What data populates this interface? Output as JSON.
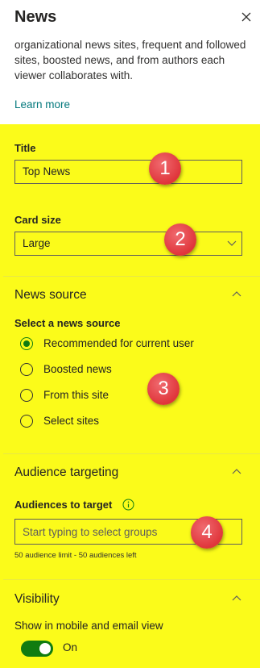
{
  "panel": {
    "title": "News",
    "description": "organizational news sites, frequent and followed sites, boosted news, and from authors each viewer collaborates with.",
    "learn_more": "Learn more"
  },
  "title_field": {
    "label": "Title",
    "value": "Top News"
  },
  "card_size": {
    "label": "Card size",
    "value": "Large"
  },
  "news_source": {
    "section_title": "News source",
    "subheading": "Select a news source",
    "options": [
      {
        "label": "Recommended for current user",
        "checked": true
      },
      {
        "label": "Boosted news",
        "checked": false
      },
      {
        "label": "From this site",
        "checked": false
      },
      {
        "label": "Select sites",
        "checked": false
      }
    ]
  },
  "audience": {
    "section_title": "Audience targeting",
    "label": "Audiences to target",
    "placeholder": "Start typing to select groups",
    "limit_note": "50 audience limit - 50 audiences left"
  },
  "visibility": {
    "section_title": "Visibility",
    "toggle_label": "Show in mobile and email view",
    "toggle_state": "On",
    "enabled": true
  },
  "annotations": [
    "1",
    "2",
    "3",
    "4"
  ],
  "colors": {
    "highlight": "#fbfb1a",
    "accent": "#107c10",
    "link": "#03787c",
    "badge": "#e0353b"
  }
}
